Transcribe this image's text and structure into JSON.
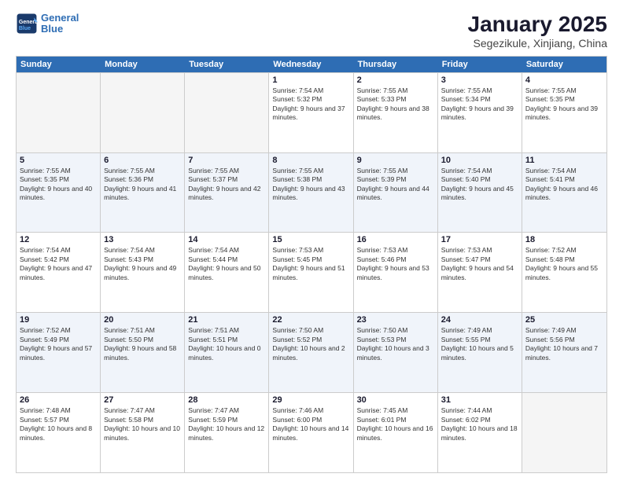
{
  "logo": {
    "line1": "General",
    "line2": "Blue"
  },
  "title": "January 2025",
  "subtitle": "Segezikule, Xinjiang, China",
  "days": [
    "Sunday",
    "Monday",
    "Tuesday",
    "Wednesday",
    "Thursday",
    "Friday",
    "Saturday"
  ],
  "weeks": [
    [
      {
        "day": "",
        "sunrise": "",
        "sunset": "",
        "daylight": "",
        "empty": true
      },
      {
        "day": "",
        "sunrise": "",
        "sunset": "",
        "daylight": "",
        "empty": true
      },
      {
        "day": "",
        "sunrise": "",
        "sunset": "",
        "daylight": "",
        "empty": true
      },
      {
        "day": "1",
        "sunrise": "Sunrise: 7:54 AM",
        "sunset": "Sunset: 5:32 PM",
        "daylight": "Daylight: 9 hours and 37 minutes."
      },
      {
        "day": "2",
        "sunrise": "Sunrise: 7:55 AM",
        "sunset": "Sunset: 5:33 PM",
        "daylight": "Daylight: 9 hours and 38 minutes."
      },
      {
        "day": "3",
        "sunrise": "Sunrise: 7:55 AM",
        "sunset": "Sunset: 5:34 PM",
        "daylight": "Daylight: 9 hours and 39 minutes."
      },
      {
        "day": "4",
        "sunrise": "Sunrise: 7:55 AM",
        "sunset": "Sunset: 5:35 PM",
        "daylight": "Daylight: 9 hours and 39 minutes."
      }
    ],
    [
      {
        "day": "5",
        "sunrise": "Sunrise: 7:55 AM",
        "sunset": "Sunset: 5:35 PM",
        "daylight": "Daylight: 9 hours and 40 minutes."
      },
      {
        "day": "6",
        "sunrise": "Sunrise: 7:55 AM",
        "sunset": "Sunset: 5:36 PM",
        "daylight": "Daylight: 9 hours and 41 minutes."
      },
      {
        "day": "7",
        "sunrise": "Sunrise: 7:55 AM",
        "sunset": "Sunset: 5:37 PM",
        "daylight": "Daylight: 9 hours and 42 minutes."
      },
      {
        "day": "8",
        "sunrise": "Sunrise: 7:55 AM",
        "sunset": "Sunset: 5:38 PM",
        "daylight": "Daylight: 9 hours and 43 minutes."
      },
      {
        "day": "9",
        "sunrise": "Sunrise: 7:55 AM",
        "sunset": "Sunset: 5:39 PM",
        "daylight": "Daylight: 9 hours and 44 minutes."
      },
      {
        "day": "10",
        "sunrise": "Sunrise: 7:54 AM",
        "sunset": "Sunset: 5:40 PM",
        "daylight": "Daylight: 9 hours and 45 minutes."
      },
      {
        "day": "11",
        "sunrise": "Sunrise: 7:54 AM",
        "sunset": "Sunset: 5:41 PM",
        "daylight": "Daylight: 9 hours and 46 minutes."
      }
    ],
    [
      {
        "day": "12",
        "sunrise": "Sunrise: 7:54 AM",
        "sunset": "Sunset: 5:42 PM",
        "daylight": "Daylight: 9 hours and 47 minutes."
      },
      {
        "day": "13",
        "sunrise": "Sunrise: 7:54 AM",
        "sunset": "Sunset: 5:43 PM",
        "daylight": "Daylight: 9 hours and 49 minutes."
      },
      {
        "day": "14",
        "sunrise": "Sunrise: 7:54 AM",
        "sunset": "Sunset: 5:44 PM",
        "daylight": "Daylight: 9 hours and 50 minutes."
      },
      {
        "day": "15",
        "sunrise": "Sunrise: 7:53 AM",
        "sunset": "Sunset: 5:45 PM",
        "daylight": "Daylight: 9 hours and 51 minutes."
      },
      {
        "day": "16",
        "sunrise": "Sunrise: 7:53 AM",
        "sunset": "Sunset: 5:46 PM",
        "daylight": "Daylight: 9 hours and 53 minutes."
      },
      {
        "day": "17",
        "sunrise": "Sunrise: 7:53 AM",
        "sunset": "Sunset: 5:47 PM",
        "daylight": "Daylight: 9 hours and 54 minutes."
      },
      {
        "day": "18",
        "sunrise": "Sunrise: 7:52 AM",
        "sunset": "Sunset: 5:48 PM",
        "daylight": "Daylight: 9 hours and 55 minutes."
      }
    ],
    [
      {
        "day": "19",
        "sunrise": "Sunrise: 7:52 AM",
        "sunset": "Sunset: 5:49 PM",
        "daylight": "Daylight: 9 hours and 57 minutes."
      },
      {
        "day": "20",
        "sunrise": "Sunrise: 7:51 AM",
        "sunset": "Sunset: 5:50 PM",
        "daylight": "Daylight: 9 hours and 58 minutes."
      },
      {
        "day": "21",
        "sunrise": "Sunrise: 7:51 AM",
        "sunset": "Sunset: 5:51 PM",
        "daylight": "Daylight: 10 hours and 0 minutes."
      },
      {
        "day": "22",
        "sunrise": "Sunrise: 7:50 AM",
        "sunset": "Sunset: 5:52 PM",
        "daylight": "Daylight: 10 hours and 2 minutes."
      },
      {
        "day": "23",
        "sunrise": "Sunrise: 7:50 AM",
        "sunset": "Sunset: 5:53 PM",
        "daylight": "Daylight: 10 hours and 3 minutes."
      },
      {
        "day": "24",
        "sunrise": "Sunrise: 7:49 AM",
        "sunset": "Sunset: 5:55 PM",
        "daylight": "Daylight: 10 hours and 5 minutes."
      },
      {
        "day": "25",
        "sunrise": "Sunrise: 7:49 AM",
        "sunset": "Sunset: 5:56 PM",
        "daylight": "Daylight: 10 hours and 7 minutes."
      }
    ],
    [
      {
        "day": "26",
        "sunrise": "Sunrise: 7:48 AM",
        "sunset": "Sunset: 5:57 PM",
        "daylight": "Daylight: 10 hours and 8 minutes."
      },
      {
        "day": "27",
        "sunrise": "Sunrise: 7:47 AM",
        "sunset": "Sunset: 5:58 PM",
        "daylight": "Daylight: 10 hours and 10 minutes."
      },
      {
        "day": "28",
        "sunrise": "Sunrise: 7:47 AM",
        "sunset": "Sunset: 5:59 PM",
        "daylight": "Daylight: 10 hours and 12 minutes."
      },
      {
        "day": "29",
        "sunrise": "Sunrise: 7:46 AM",
        "sunset": "Sunset: 6:00 PM",
        "daylight": "Daylight: 10 hours and 14 minutes."
      },
      {
        "day": "30",
        "sunrise": "Sunrise: 7:45 AM",
        "sunset": "Sunset: 6:01 PM",
        "daylight": "Daylight: 10 hours and 16 minutes."
      },
      {
        "day": "31",
        "sunrise": "Sunrise: 7:44 AM",
        "sunset": "Sunset: 6:02 PM",
        "daylight": "Daylight: 10 hours and 18 minutes."
      },
      {
        "day": "",
        "sunrise": "",
        "sunset": "",
        "daylight": "",
        "empty": true
      }
    ]
  ]
}
